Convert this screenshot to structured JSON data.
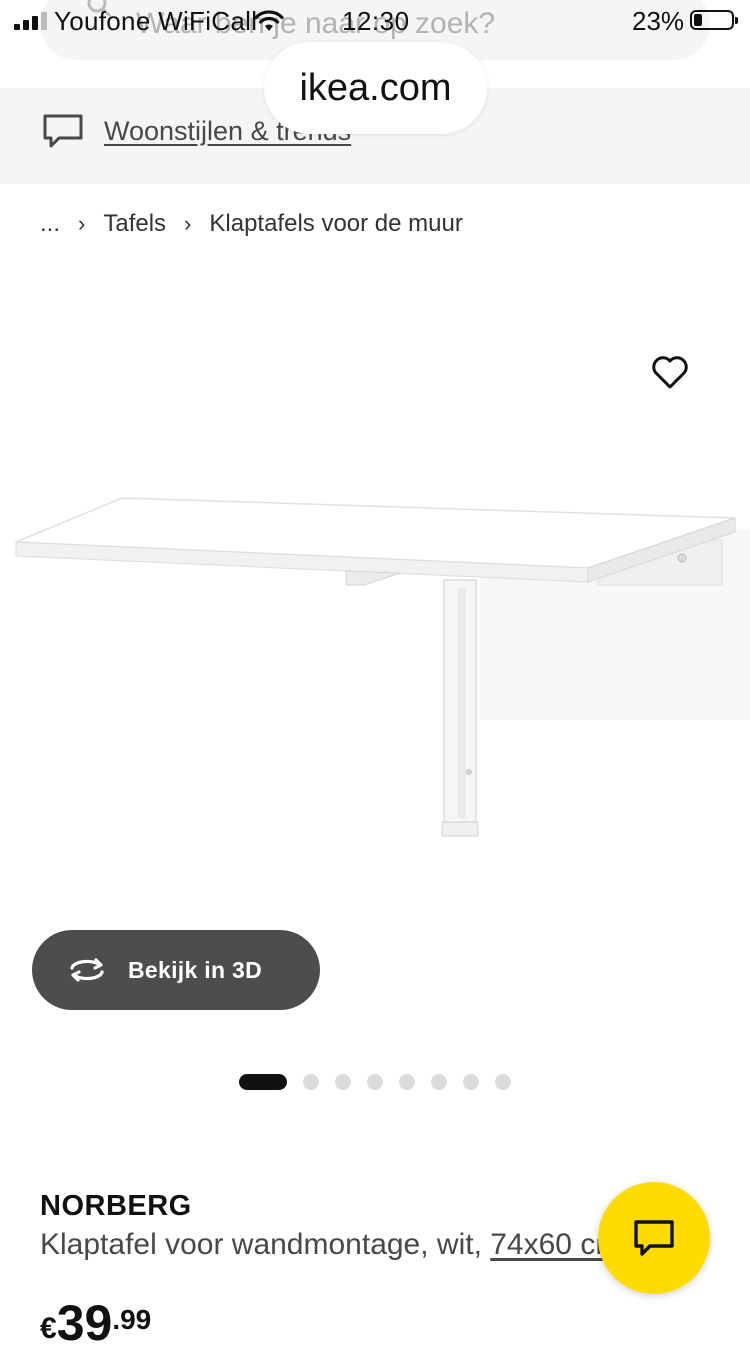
{
  "status_bar": {
    "carrier": "Youfone WiFiCall",
    "time": "12:30",
    "battery": "23%",
    "battery_level": 0.23
  },
  "search": {
    "placeholder": "Waar ben je naar op zoek?"
  },
  "browser": {
    "url": "ikea.com"
  },
  "header": {
    "styles_link": "Woonstijlen & trends"
  },
  "breadcrumb": {
    "items": [
      "...",
      "Tafels",
      "Klaptafels voor de muur"
    ]
  },
  "gallery": {
    "view_3d_label": "Bekijk in 3D",
    "image_count": 8,
    "active_index": 0
  },
  "product": {
    "name": "NORBERG",
    "description": "Klaptafel voor wandmontage, wit, ",
    "size": "74x60 cm",
    "price_currency": "€",
    "price_integer": "39",
    "price_decimals": ".99"
  },
  "colors": {
    "accent_yellow": "#ffdb00",
    "button_dark": "#4d4d4d",
    "text": "#111111",
    "muted": "#484848"
  }
}
